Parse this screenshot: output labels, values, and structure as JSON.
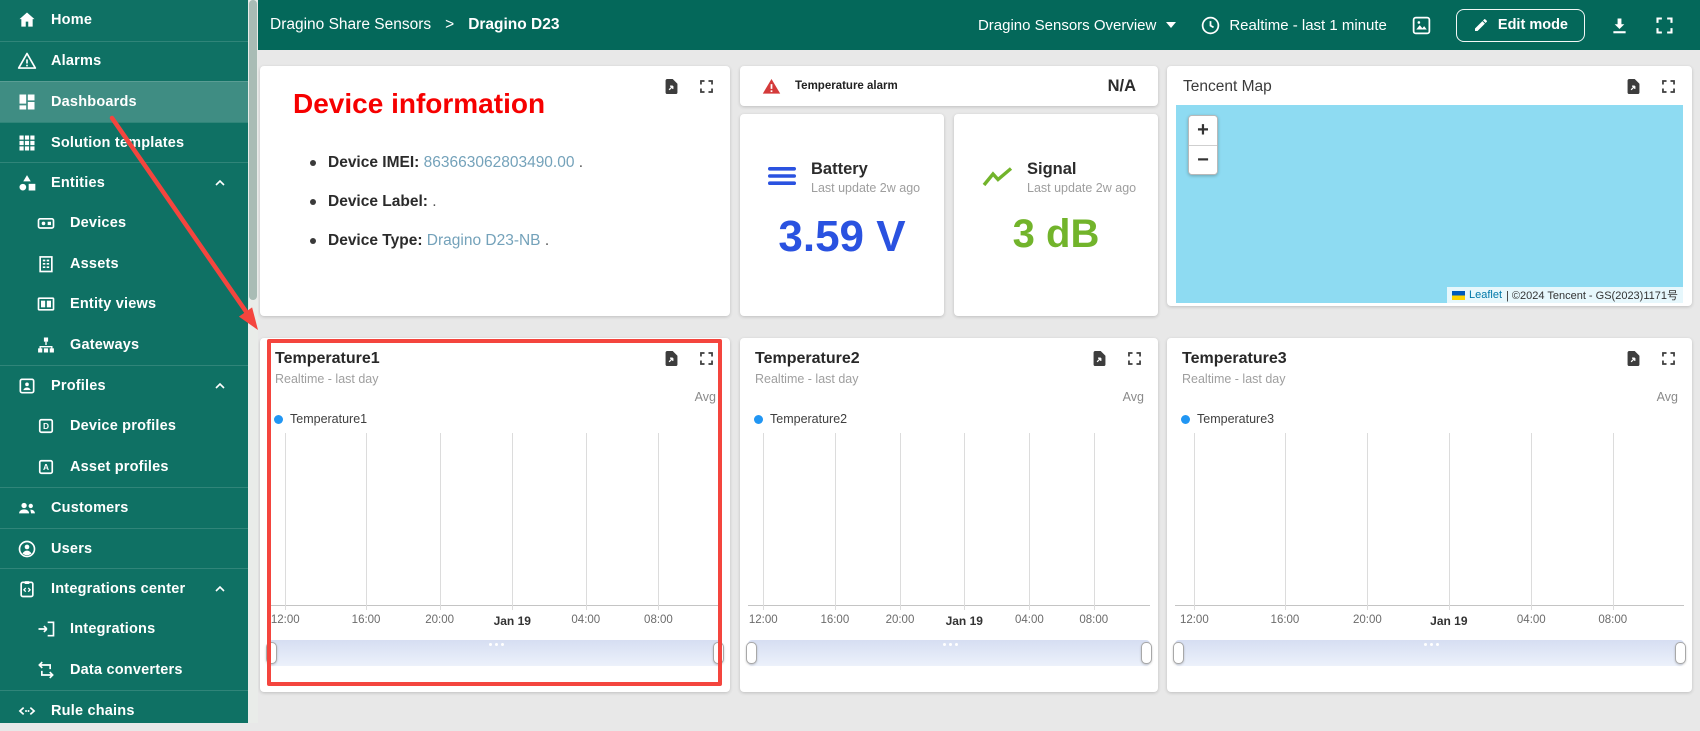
{
  "app": {
    "sidebar_color": "#0f7164",
    "header_color": "#04685a",
    "content_bg": "#e8e8e8",
    "annotation_color": "#f4453e"
  },
  "sidebar": {
    "items": [
      {
        "label": "Home",
        "icon": "home-icon"
      },
      {
        "label": "Alarms",
        "icon": "warning-icon"
      },
      {
        "label": "Dashboards",
        "icon": "dashboards-icon",
        "selected": true
      },
      {
        "label": "Solution templates",
        "icon": "grid-icon"
      },
      {
        "label": "Entities",
        "icon": "shapes-icon",
        "expanded": true
      },
      {
        "label": "Devices",
        "icon": "device-icon",
        "child": true
      },
      {
        "label": "Assets",
        "icon": "building-icon",
        "child": true
      },
      {
        "label": "Entity views",
        "icon": "columns-icon",
        "child": true
      },
      {
        "label": "Gateways",
        "icon": "hub-icon",
        "child": true
      },
      {
        "label": "Profiles",
        "icon": "badge-icon",
        "expanded": true
      },
      {
        "label": "Device profiles",
        "icon": "letter-d-icon",
        "child": true
      },
      {
        "label": "Asset profiles",
        "icon": "letter-a-icon",
        "child": true
      },
      {
        "label": "Customers",
        "icon": "people-icon"
      },
      {
        "label": "Users",
        "icon": "person-circle-icon"
      },
      {
        "label": "Integrations center",
        "icon": "clipboard-code-icon",
        "expanded": true
      },
      {
        "label": "Integrations",
        "icon": "arrow-into-box-icon",
        "child": true
      },
      {
        "label": "Data converters",
        "icon": "transform-icon",
        "child": true
      },
      {
        "label": "Rule chains",
        "icon": "code-angle-icon"
      }
    ]
  },
  "header": {
    "breadcrumb": {
      "root": "Dragino Share Sensors",
      "separator": ">",
      "current": "Dragino D23"
    },
    "dashboard_select": "Dragino Sensors Overview",
    "timewindow": "Realtime - last 1 minute",
    "edit_button": "Edit mode",
    "icons": [
      "caret-down-icon",
      "clock-icon",
      "image-icon",
      "pencil-icon",
      "download-icon",
      "fullscreen-icon"
    ]
  },
  "device_info_card": {
    "title": "Device information",
    "title_color": "#f60000",
    "value_color": "#74a2ba",
    "items": [
      {
        "label": "Device IMEI:",
        "value": "863663062803490.00",
        "suffix": " ."
      },
      {
        "label": "Device Label:",
        "value": "",
        "suffix": " ."
      },
      {
        "label": "Device Type:",
        "value": "Dragino D23-NB",
        "suffix": " ."
      }
    ],
    "icons": [
      "export-file-icon",
      "expand-icon"
    ]
  },
  "alarm_card": {
    "icon": "alarm-triangle-icon",
    "label": "Temperature alarm",
    "value": "N/A"
  },
  "battery_card": {
    "icon": "battery-bars-icon",
    "title": "Battery",
    "subtitle": "Last update 2w ago",
    "value": "3.59 V",
    "accent": "#2a52e0"
  },
  "signal_card": {
    "icon": "signal-line-icon",
    "title": "Signal",
    "subtitle": "Last update 2w ago",
    "value": "3 dB",
    "accent": "#72b42b"
  },
  "map_card": {
    "title": "Tencent Map",
    "zoom_in": "+",
    "zoom_out": "−",
    "water_color": "#8edbf2",
    "attribution": {
      "flag_icon": "ukraine-flag-icon",
      "leaflet": "Leaflet",
      "text": " | ©2024 Tencent - GS(2023)1171号"
    },
    "icons": [
      "export-file-icon",
      "expand-icon"
    ]
  },
  "chart_data": [
    {
      "type": "line",
      "title": "Temperature1",
      "subtitle": "Realtime - last day",
      "aggregation": "Avg",
      "legend": [
        {
          "name": "Temperature1",
          "color": "#2196f3"
        }
      ],
      "series": [
        {
          "name": "Temperature1",
          "values": []
        }
      ],
      "x_ticks": [
        "12:00",
        "16:00",
        "20:00",
        "Jan 19",
        "04:00",
        "08:00"
      ],
      "grid": "vertical-gridlines-only",
      "note": "no data points rendered in visible window",
      "highlighted_by_red_annotation": true
    },
    {
      "type": "line",
      "title": "Temperature2",
      "subtitle": "Realtime - last day",
      "aggregation": "Avg",
      "legend": [
        {
          "name": "Temperature2",
          "color": "#2196f3"
        }
      ],
      "series": [
        {
          "name": "Temperature2",
          "values": []
        }
      ],
      "x_ticks": [
        "12:00",
        "16:00",
        "20:00",
        "Jan 19",
        "04:00",
        "08:00"
      ],
      "grid": "vertical-gridlines-only",
      "note": "no data points rendered in visible window"
    },
    {
      "type": "line",
      "title": "Temperature3",
      "subtitle": "Realtime - last day",
      "aggregation": "Avg",
      "legend": [
        {
          "name": "Temperature3",
          "color": "#2196f3"
        }
      ],
      "series": [
        {
          "name": "Temperature3",
          "values": []
        }
      ],
      "x_ticks": [
        "12:00",
        "16:00",
        "20:00",
        "Jan 19",
        "04:00",
        "08:00"
      ],
      "grid": "vertical-gridlines-only",
      "note": "no data points rendered in visible window"
    }
  ]
}
